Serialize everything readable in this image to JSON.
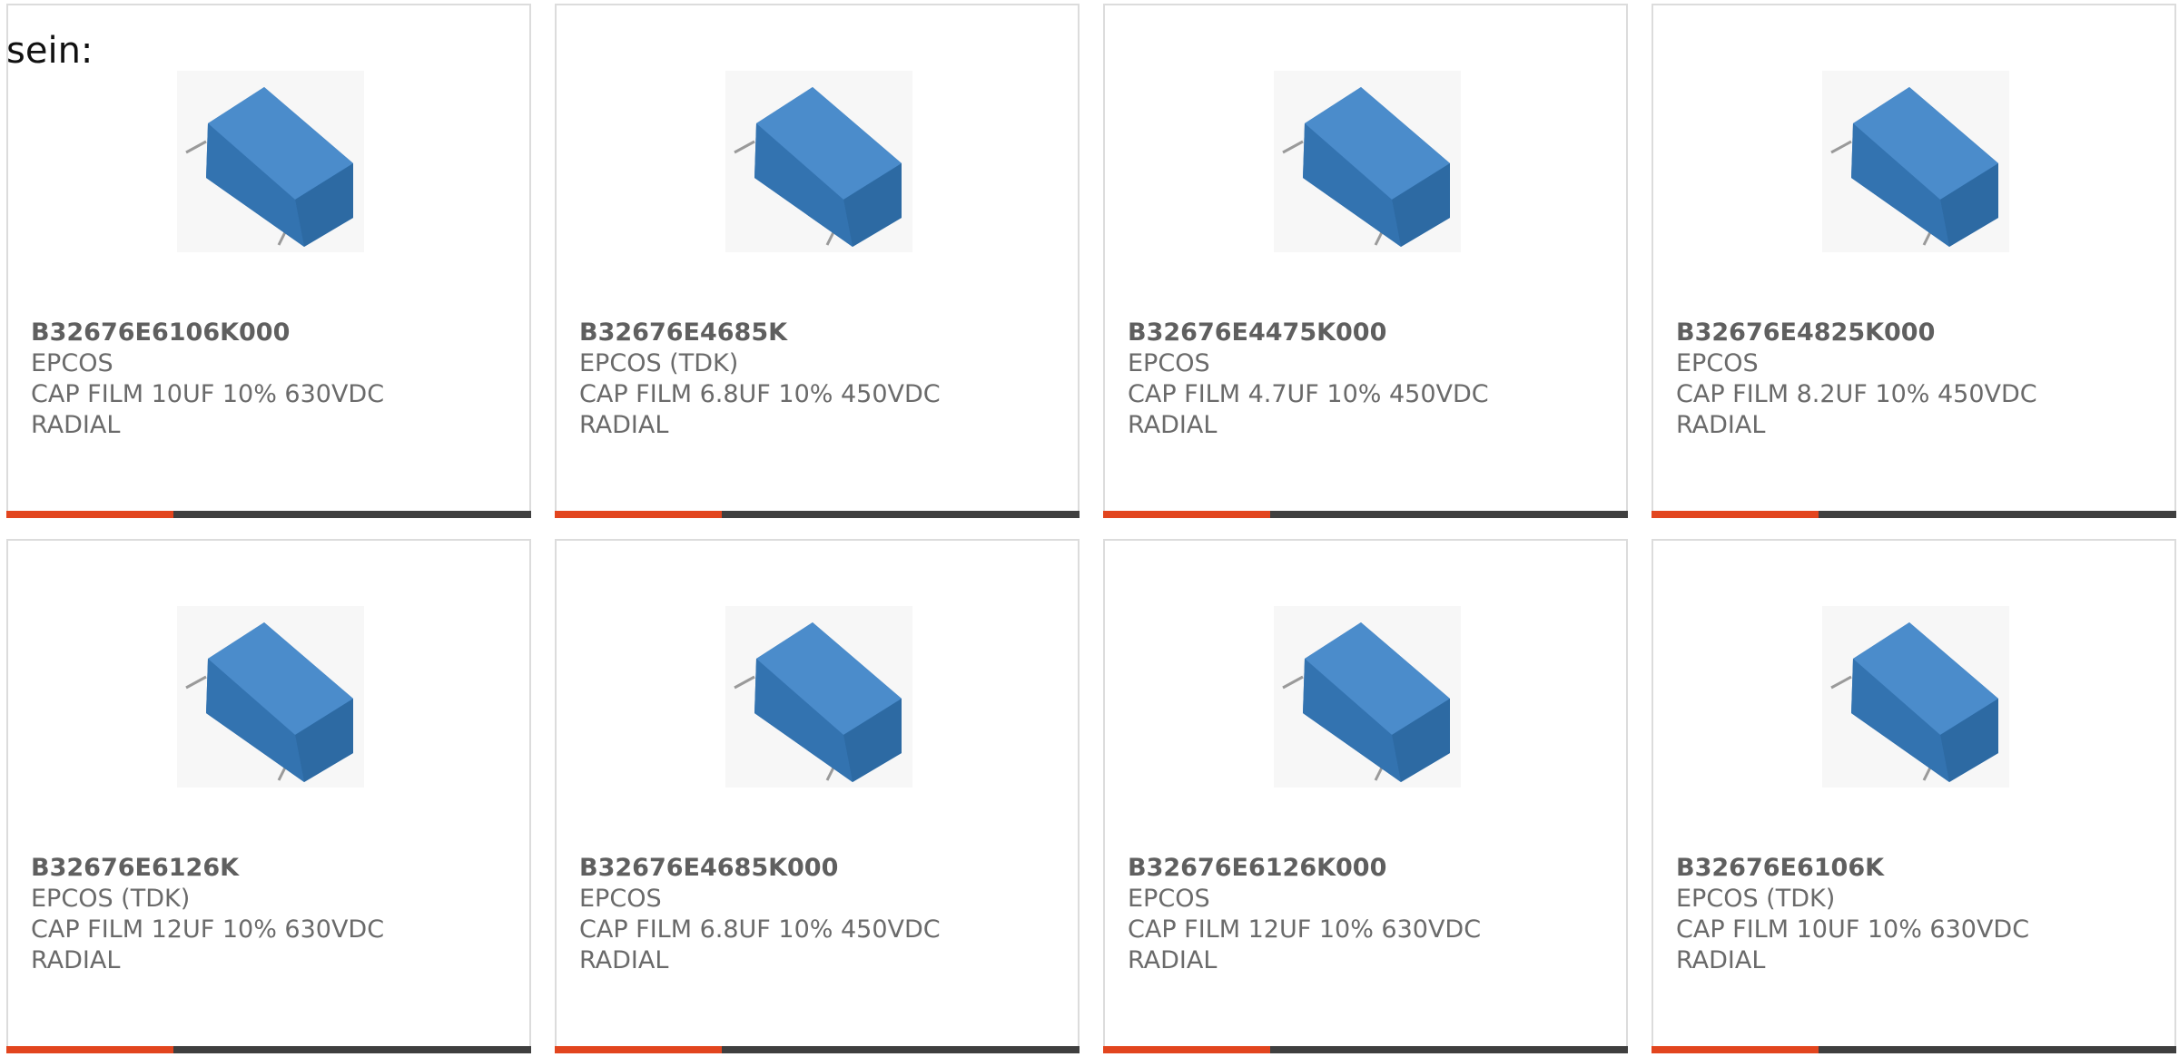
{
  "intro": "sein:",
  "colors": {
    "accent": "#e2451e",
    "bar": "#3f3f3f",
    "capacitor": "#3a7ab8"
  },
  "products": [
    {
      "part": "B32676E6106K000",
      "maker": "EPCOS",
      "desc": "CAP FILM 10UF 10% 630VDC",
      "desc2": "RADIAL",
      "image": "capacitor-image"
    },
    {
      "part": "B32676E4685K",
      "maker": "EPCOS (TDK)",
      "desc": "CAP FILM 6.8UF 10% 450VDC",
      "desc2": "RADIAL",
      "image": "capacitor-image"
    },
    {
      "part": "B32676E4475K000",
      "maker": "EPCOS",
      "desc": "CAP FILM 4.7UF 10% 450VDC",
      "desc2": "RADIAL",
      "image": "capacitor-image"
    },
    {
      "part": "B32676E4825K000",
      "maker": "EPCOS",
      "desc": "CAP FILM 8.2UF 10% 450VDC",
      "desc2": "RADIAL",
      "image": "capacitor-image"
    },
    {
      "part": "B32676E6126K",
      "maker": "EPCOS (TDK)",
      "desc": "CAP FILM 12UF 10% 630VDC",
      "desc2": "RADIAL",
      "image": "capacitor-image"
    },
    {
      "part": "B32676E4685K000",
      "maker": "EPCOS",
      "desc": "CAP FILM 6.8UF 10% 450VDC",
      "desc2": "RADIAL",
      "image": "capacitor-image"
    },
    {
      "part": "B32676E6126K000",
      "maker": "EPCOS",
      "desc": "CAP FILM 12UF 10% 630VDC",
      "desc2": "RADIAL",
      "image": "capacitor-image"
    },
    {
      "part": "B32676E6106K",
      "maker": "EPCOS (TDK)",
      "desc": "CAP FILM 10UF 10% 630VDC",
      "desc2": "RADIAL",
      "image": "capacitor-image"
    }
  ]
}
